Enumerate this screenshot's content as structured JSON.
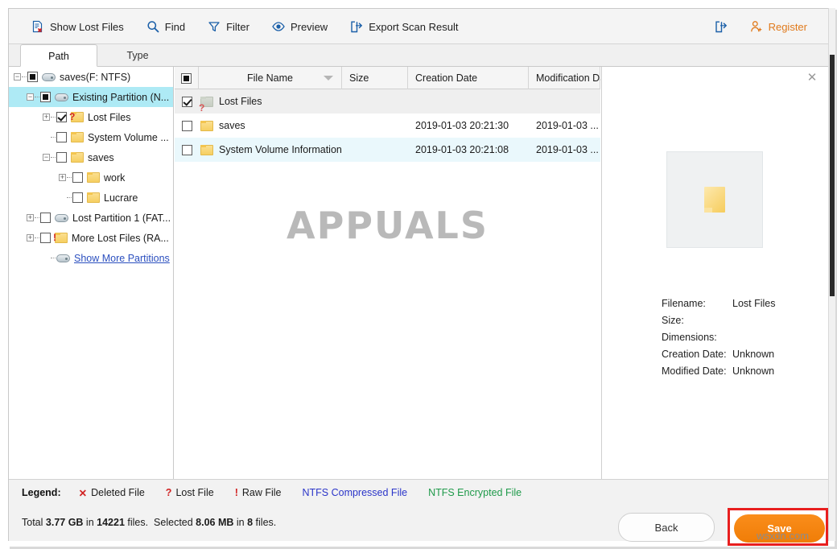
{
  "toolbar": {
    "items": [
      {
        "label": "Show Lost Files",
        "icon": "document-x-icon"
      },
      {
        "label": "Find",
        "icon": "search-icon"
      },
      {
        "label": "Filter",
        "icon": "funnel-icon"
      },
      {
        "label": "Preview",
        "icon": "eye-icon"
      },
      {
        "label": "Export Scan Result",
        "icon": "export-arrow-icon"
      }
    ],
    "share_icon": "share-icon",
    "register_label": "Register",
    "register_icon": "user-plus-icon",
    "accent_color": "#e07a1c"
  },
  "tabs": [
    {
      "label": "Path",
      "active": true
    },
    {
      "label": "Type",
      "active": false
    }
  ],
  "tree": {
    "nodes": [
      {
        "label": "saves(F: NTFS)",
        "icon": "drive-icon",
        "indent": 0,
        "expander": "minus",
        "check": "filled",
        "selected": false,
        "badge": ""
      },
      {
        "label": "Existing Partition (N...",
        "icon": "drive-icon",
        "indent": 1,
        "expander": "minus",
        "check": "filled",
        "selected": true,
        "badge": ""
      },
      {
        "label": "Lost Files",
        "icon": "folder-icon",
        "indent": 2,
        "expander": "plus",
        "check": "check",
        "selected": false,
        "badge": "?"
      },
      {
        "label": "System Volume ...",
        "icon": "folder-icon",
        "indent": 2,
        "expander": "none",
        "check": "empty",
        "selected": false,
        "badge": ""
      },
      {
        "label": "saves",
        "icon": "folder-icon",
        "indent": 2,
        "expander": "minus",
        "check": "empty",
        "selected": false,
        "badge": ""
      },
      {
        "label": "work",
        "icon": "folder-icon",
        "indent": 3,
        "expander": "plus",
        "check": "empty",
        "selected": false,
        "badge": ""
      },
      {
        "label": "Lucrare",
        "icon": "folder-icon",
        "indent": 3,
        "expander": "none",
        "check": "empty",
        "selected": false,
        "badge": ""
      },
      {
        "label": "Lost Partition 1 (FAT...",
        "icon": "drive-icon",
        "indent": 1,
        "expander": "plus",
        "check": "empty",
        "selected": false,
        "badge": ""
      },
      {
        "label": "More Lost Files (RA...",
        "icon": "folder-icon",
        "indent": 1,
        "expander": "plus",
        "check": "empty",
        "selected": false,
        "badge": "!"
      },
      {
        "label": "Show More Partitions",
        "icon": "drive-icon",
        "indent": 1,
        "expander": "none",
        "check": "hidden",
        "selected": false,
        "badge": "",
        "link": true
      }
    ]
  },
  "filelist": {
    "columns": [
      {
        "key": "check",
        "label": ""
      },
      {
        "key": "name",
        "label": "File Name"
      },
      {
        "key": "size",
        "label": "Size"
      },
      {
        "key": "creation",
        "label": "Creation Date"
      },
      {
        "key": "modification",
        "label": "Modification Dat"
      }
    ],
    "rows": [
      {
        "checked": true,
        "icon": "folder-question-icon",
        "name": "Lost Files",
        "size": "",
        "creation": "",
        "modification": "",
        "state": "selected"
      },
      {
        "checked": false,
        "icon": "folder-icon",
        "name": "saves",
        "size": "",
        "creation": "2019-01-03 20:21:30",
        "modification": "2019-01-03 ...",
        "state": "normal"
      },
      {
        "checked": false,
        "icon": "folder-icon",
        "name": "System Volume Information",
        "size": "",
        "creation": "2019-01-03 20:21:08",
        "modification": "2019-01-03 ...",
        "state": "alt"
      }
    ],
    "watermark": "APPUALS"
  },
  "preview": {
    "close_icon": "close-icon",
    "thumbnail_icon": "folder-large-icon",
    "fields": [
      {
        "key": "Filename:",
        "value": "Lost Files"
      },
      {
        "key": "Size:",
        "value": ""
      },
      {
        "key": "Dimensions:",
        "value": ""
      },
      {
        "key": "Creation Date:",
        "value": "Unknown"
      },
      {
        "key": "Modified Date:",
        "value": "Unknown"
      }
    ]
  },
  "legend": {
    "title": "Legend:",
    "items": [
      {
        "mark": "✕",
        "label": "Deleted File",
        "style": "mark-red"
      },
      {
        "mark": "?",
        "label": "Lost File",
        "style": "mark-red"
      },
      {
        "mark": "!",
        "label": "Raw File",
        "style": "mark-red"
      },
      {
        "mark": "",
        "label": "NTFS Compressed File",
        "style": "blue"
      },
      {
        "mark": "",
        "label": "NTFS Encrypted File",
        "style": "green"
      }
    ]
  },
  "status": {
    "total_prefix": "Total ",
    "total_size": "3.77 GB",
    "total_mid": " in ",
    "total_count": "14221",
    "total_suffix": " files.",
    "selected_prefix": "Selected ",
    "selected_size": "8.06 MB",
    "selected_mid": " in ",
    "selected_count": "8",
    "selected_suffix": " files.",
    "back_label": "Back",
    "save_label": "Save",
    "save_color": "#f28118",
    "highlight_color": "#e81f1f"
  },
  "watermark_site": "wsxdn.com"
}
